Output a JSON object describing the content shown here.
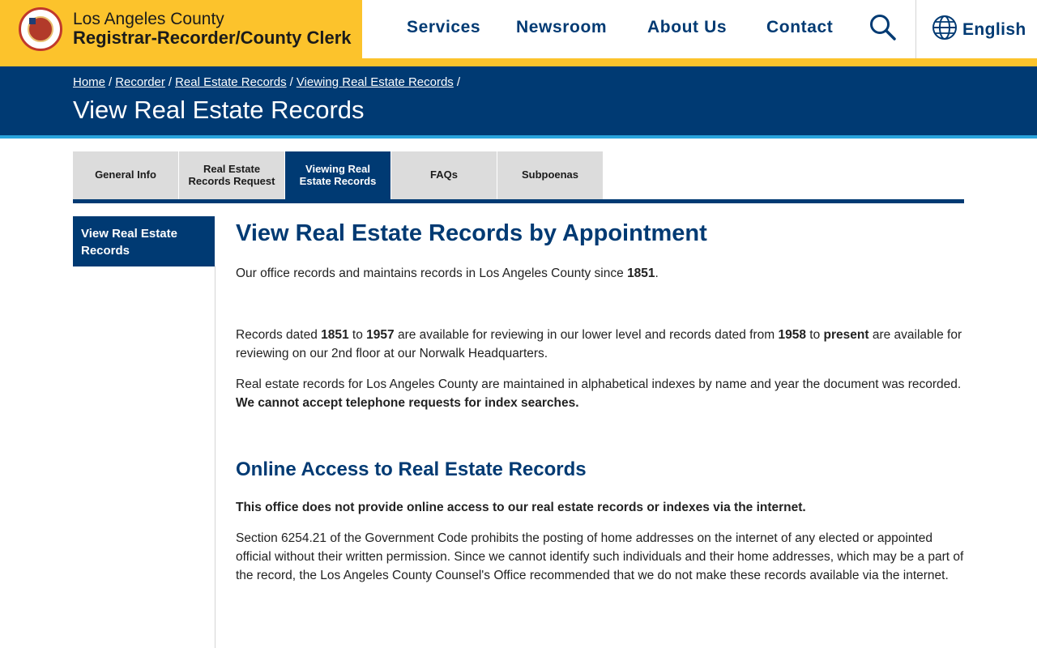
{
  "header": {
    "brand_line1": "Los Angeles County",
    "brand_line2": "Registrar-Recorder/County Clerk",
    "nav": [
      "Services",
      "Newsroom",
      "About Us",
      "Contact"
    ],
    "language": "English",
    "icons": {
      "search": "search-icon",
      "globe": "globe-icon",
      "seal": "county-seal-logo"
    },
    "colors": {
      "brand_yellow": "#fcc32c",
      "navy": "#003a73",
      "accent_blue": "#29a3dc"
    }
  },
  "breadcrumb": {
    "items": [
      "Home",
      "Recorder",
      "Real Estate Records",
      "Viewing Real Estate Records"
    ],
    "separator": "/"
  },
  "page_title": "View Real Estate Records",
  "tabs": [
    {
      "label": "General Info",
      "active": false
    },
    {
      "label": "Real Estate Records Request",
      "active": false
    },
    {
      "label": "Viewing Real Estate Records",
      "active": true
    },
    {
      "label": "FAQs",
      "active": false
    },
    {
      "label": "Subpoenas",
      "active": false
    }
  ],
  "sidebar": {
    "items": [
      "View Real Estate Records"
    ]
  },
  "content": {
    "heading": "View Real Estate Records by Appointment",
    "p1": {
      "a": "Our office records and maintains records in Los Angeles County since ",
      "b": "1851",
      "c": "."
    },
    "p2": {
      "t1": "Records dated ",
      "b1": "1851",
      "t2": " to ",
      "b2": "1957",
      "t3": " are available for reviewing in our lower level and records dated from ",
      "b3": "1958",
      "t4": " to ",
      "b4": "present",
      "t5": " are available for reviewing on our 2nd floor at our Norwalk Headquarters."
    },
    "p3": {
      "t1": "Real estate records for Los Angeles County are maintained in alphabetical indexes by name and year the document was recorded. ",
      "b1": "We cannot accept telephone requests for index searches."
    },
    "heading2": "Online Access to Real Estate Records",
    "p4": "This office does not provide online access to our real estate records or indexes via the internet.",
    "p5": "Section 6254.21 of the Government Code prohibits the posting of home addresses on the internet of any elected or appointed official without their written permission. Since we cannot identify such individuals and their home addresses, which may be a part of the record, the Los Angeles County Counsel's Office recommended that we do not make these records available via the internet."
  }
}
